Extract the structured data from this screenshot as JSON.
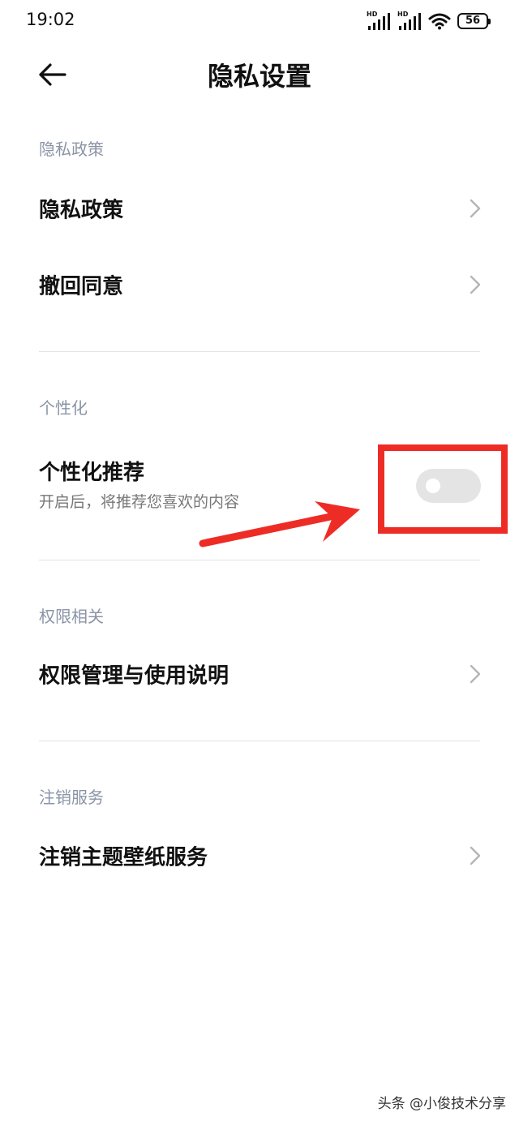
{
  "status_bar": {
    "time": "19:02",
    "signal1_label": "HD",
    "signal2_label": "HD",
    "battery_level": "56",
    "icons": [
      "signal-icon",
      "signal-icon",
      "wifi-icon",
      "battery-icon"
    ]
  },
  "header": {
    "title": "隐私设置",
    "back_icon": "arrow-left-icon"
  },
  "sections": {
    "privacy": {
      "header": "隐私政策",
      "items": [
        {
          "label": "隐私政策"
        },
        {
          "label": "撤回同意"
        }
      ]
    },
    "personalization": {
      "header": "个性化",
      "item": {
        "title": "个性化推荐",
        "subtitle": "开启后，将推荐您喜欢的内容",
        "toggle_on": false
      }
    },
    "permissions": {
      "header": "权限相关",
      "items": [
        {
          "label": "权限管理与使用说明"
        }
      ]
    },
    "cancellation": {
      "header": "注销服务",
      "items": [
        {
          "label": "注销主题壁纸服务"
        }
      ]
    }
  },
  "annotation": {
    "highlight_color": "#ee2c26"
  },
  "colors": {
    "section_header": "#8a94a6",
    "toggle_off": "#e4e4e4",
    "divider": "#e3e3e3"
  },
  "watermark": "头条 @小俊技术分享"
}
